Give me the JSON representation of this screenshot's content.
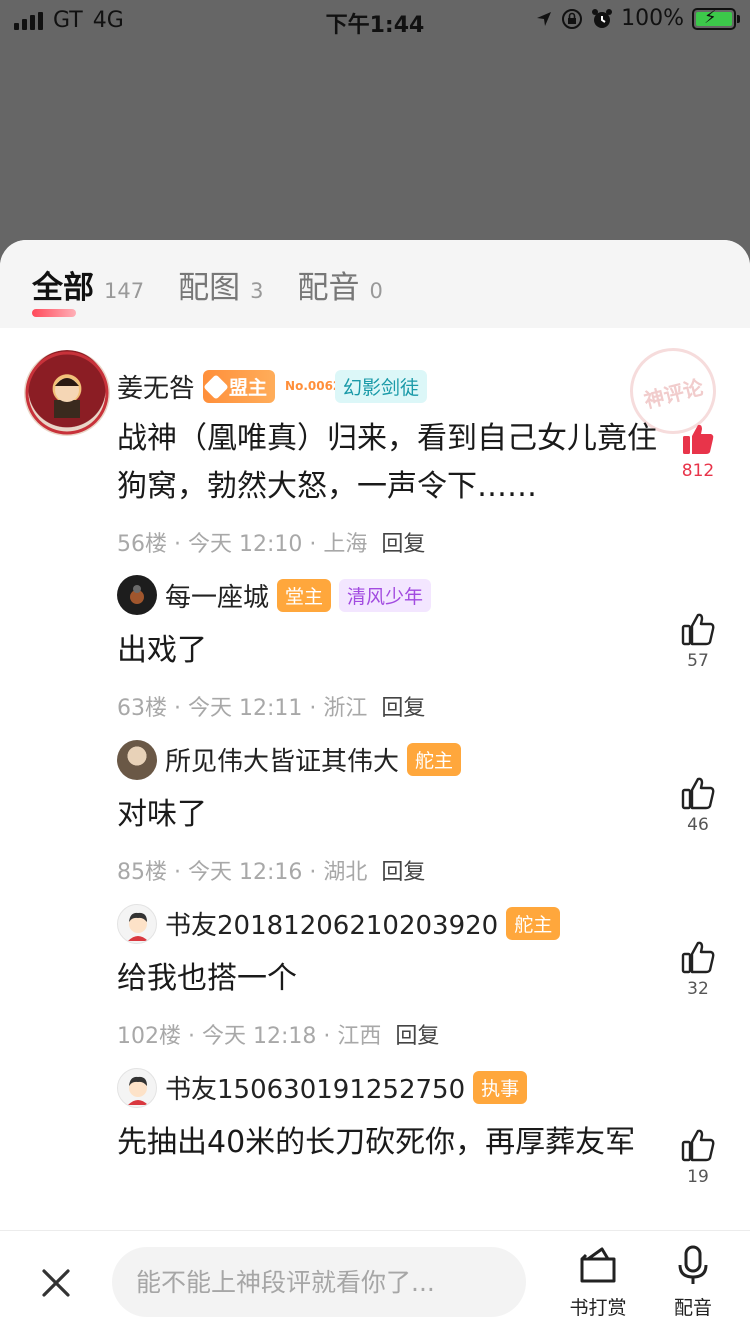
{
  "status_bar": {
    "carrier": "GT",
    "network": "4G",
    "time": "下午1:44",
    "battery": "100%"
  },
  "tabs": [
    {
      "label": "全部",
      "count": "147",
      "active": true
    },
    {
      "label": "配图",
      "count": "3",
      "active": false
    },
    {
      "label": "配音",
      "count": "0",
      "active": false
    }
  ],
  "stamp": "神评论",
  "comments": [
    {
      "username": "姜无咎",
      "badges": [
        {
          "text": "盟主",
          "extra": "No.00628"
        },
        {
          "text": "幻影剑徒"
        }
      ],
      "text": "战神（凰唯真）归来，看到自己女儿竟住狗窝，勃然大怒，一声令下……",
      "floor": "56楼",
      "time": "今天 12:10",
      "location": "上海",
      "reply": "回复",
      "likes": "812",
      "liked": true
    },
    {
      "username": "每一座城",
      "badges": [
        {
          "text": "堂主"
        },
        {
          "text": "清风少年"
        }
      ],
      "text": "出戏了",
      "floor": "63楼",
      "time": "今天 12:11",
      "location": "浙江",
      "reply": "回复",
      "likes": "57",
      "liked": false
    },
    {
      "username": "所见伟大皆证其伟大",
      "badges": [
        {
          "text": "舵主"
        }
      ],
      "text": "对味了",
      "floor": "85楼",
      "time": "今天 12:16",
      "location": "湖北",
      "reply": "回复",
      "likes": "46",
      "liked": false
    },
    {
      "username": "书友20181206210203920",
      "badges": [
        {
          "text": "舵主"
        }
      ],
      "text": "给我也搭一个",
      "floor": "102楼",
      "time": "今天 12:18",
      "location": "江西",
      "reply": "回复",
      "likes": "32",
      "liked": false
    },
    {
      "username": "书友150630191252750",
      "badges": [
        {
          "text": "执事"
        }
      ],
      "text": "先抽出40米的长刀砍死你，再厚葬友军",
      "likes": "19",
      "liked": false
    }
  ],
  "bottom_bar": {
    "input_placeholder": "能不能上神段评就看你了...",
    "reward_label": "书打赏",
    "voice_label": "配音"
  },
  "colors": {
    "accent_red": "#e8344a",
    "badge_orange": "#ffa73c",
    "overlay_gray": "#666666"
  }
}
